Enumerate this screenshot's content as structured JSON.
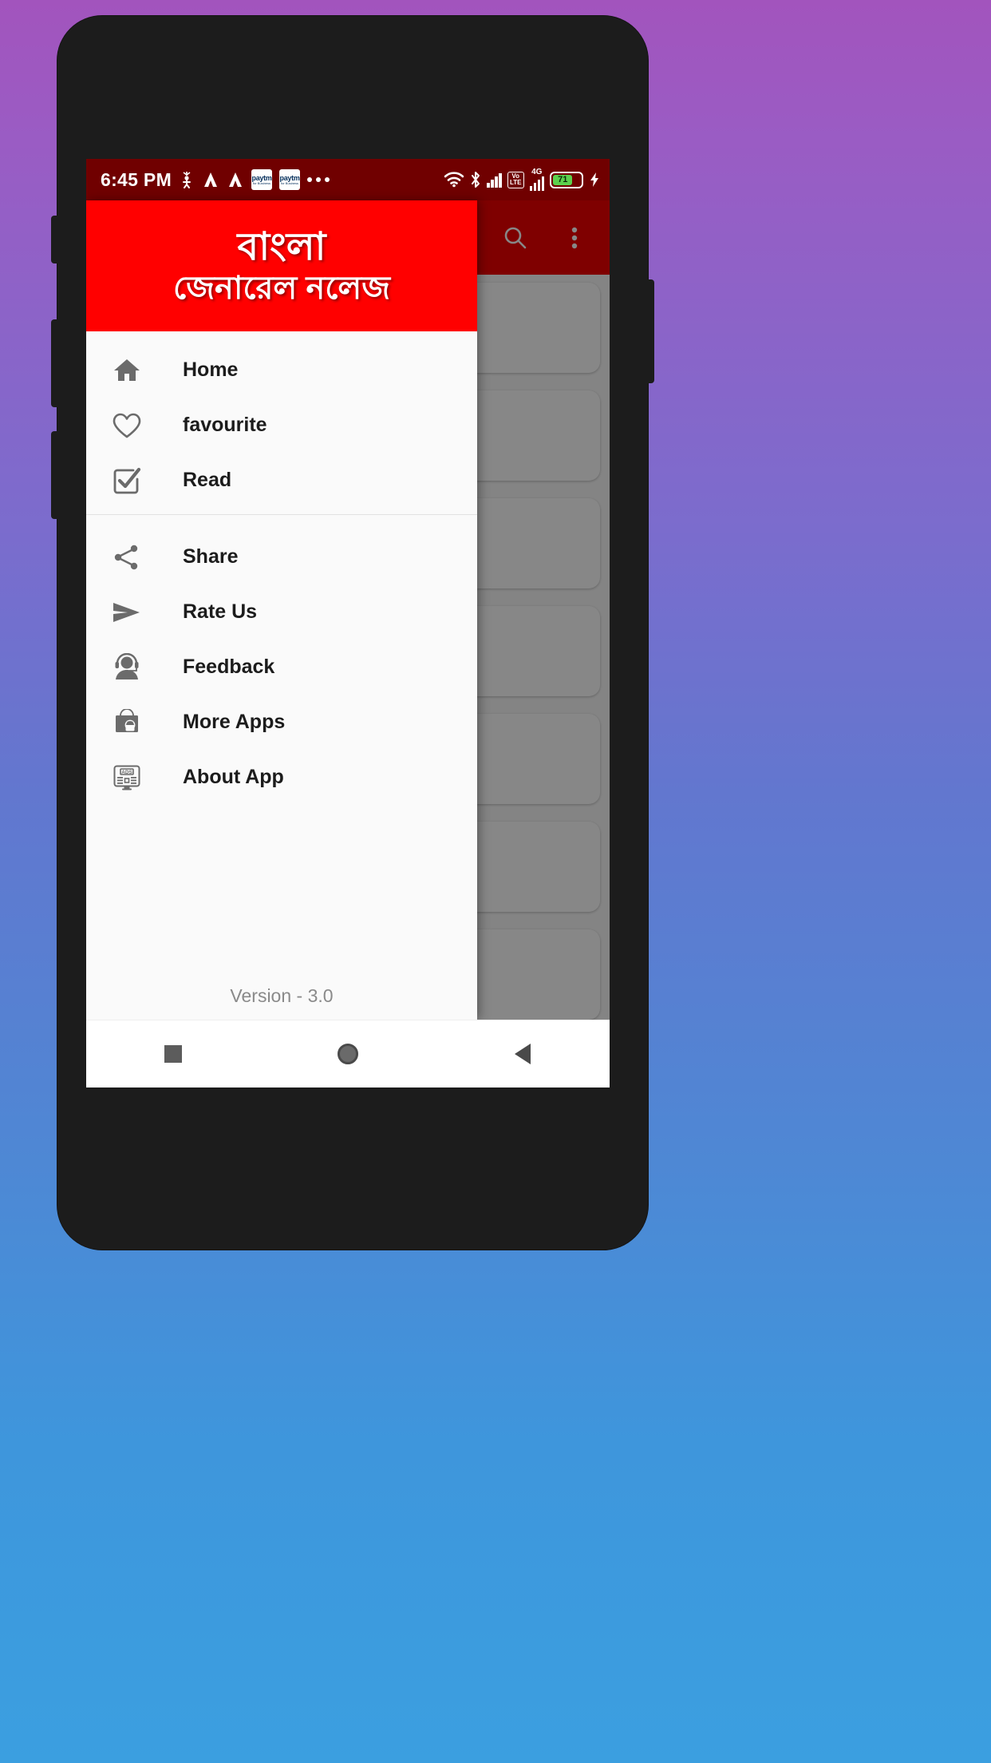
{
  "status_bar": {
    "time": "6:45 PM",
    "notification_icons": [
      "scooter-icon",
      "rapido-icon",
      "rapido-icon",
      "paytm-icon",
      "paytm-icon",
      "more-notifications-icon"
    ],
    "paytm_label": "paytm",
    "paytm_sub": "for Business",
    "wifi_icon": "wifi-icon",
    "bluetooth_icon": "bluetooth-icon",
    "signal_icon": "signal-bars-icon",
    "volte_line1": "Vo",
    "volte_line2": "LTE",
    "network_type": "4G",
    "battery_percent": "71",
    "charging_icon": "charging-bolt-icon"
  },
  "toolbar": {
    "search_icon": "search-icon",
    "overflow_icon": "overflow-menu-icon"
  },
  "drawer": {
    "title_line1": "বাংলা",
    "title_line2": "জেনারেল নলেজ",
    "groups": [
      {
        "items": [
          {
            "label": "Home",
            "icon": "home-icon"
          },
          {
            "label": "favourite",
            "icon": "heart-outline-icon"
          },
          {
            "label": "Read",
            "icon": "checkbox-checked-icon"
          }
        ]
      },
      {
        "items": [
          {
            "label": "Share",
            "icon": "share-nodes-icon"
          },
          {
            "label": "Rate Us",
            "icon": "send-arrow-icon"
          },
          {
            "label": "Feedback",
            "icon": "headset-support-icon"
          },
          {
            "label": "More Apps",
            "icon": "play-store-bag-icon"
          },
          {
            "label": "About App",
            "icon": "ads-monitor-icon"
          }
        ]
      }
    ],
    "version": "Version - 3.0"
  },
  "content": {
    "cards": [
      "",
      "",
      "",
      "",
      "",
      "",
      ""
    ]
  },
  "navbar": {
    "recents_icon": "recents-square-icon",
    "home_icon": "home-circle-icon",
    "back_icon": "back-triangle-icon"
  },
  "colors": {
    "brand_red": "#ff0000",
    "status_red": "#c20000",
    "background_gradient_start": "#a254bd",
    "background_gradient_end": "#3b9fe0",
    "battery_green": "#5cd14e"
  }
}
